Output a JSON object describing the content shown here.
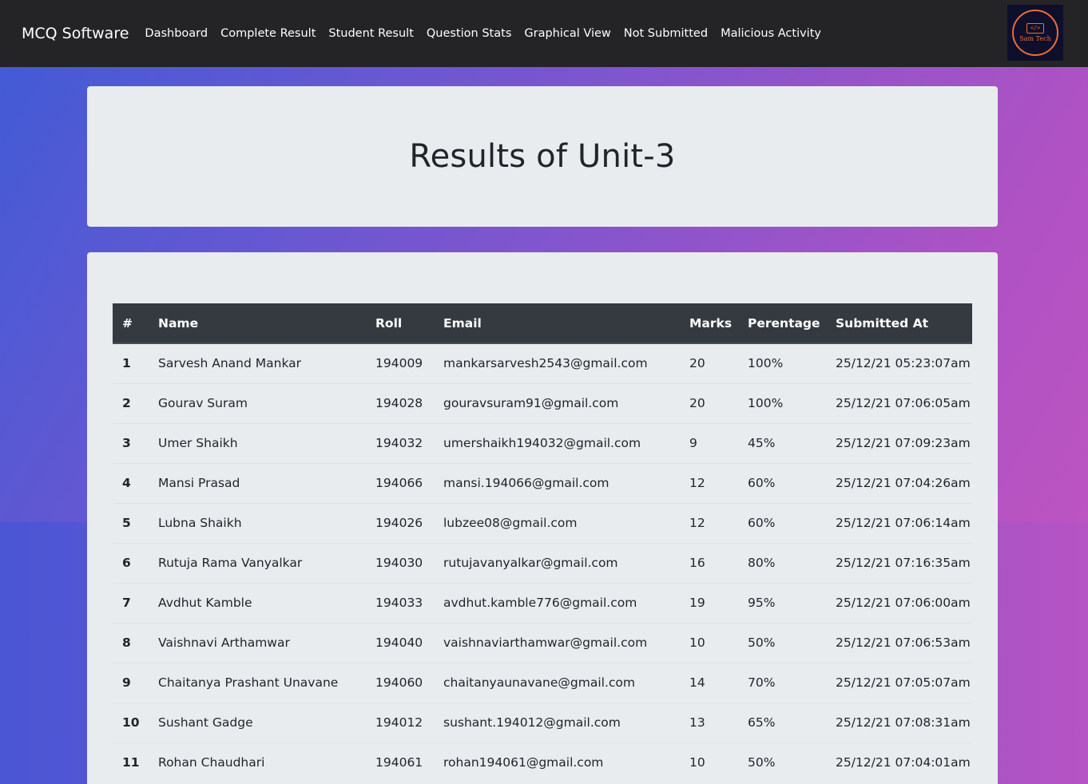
{
  "navbar": {
    "brand": "MCQ Software",
    "links": [
      "Dashboard",
      "Complete Result",
      "Student Result",
      "Question Stats",
      "Graphical View",
      "Not Submitted",
      "Malicious Activity"
    ],
    "logo_text": "Sam Tech",
    "logo_glyph": "</>"
  },
  "page": {
    "title": "Results of Unit-3"
  },
  "table": {
    "headers": [
      "#",
      "Name",
      "Roll",
      "Email",
      "Marks",
      "Perentage",
      "Submitted At"
    ],
    "rows": [
      [
        "1",
        "Sarvesh Anand Mankar",
        "194009",
        "mankarsarvesh2543@gmail.com",
        "20",
        "100%",
        "25/12/21 05:23:07am"
      ],
      [
        "2",
        "Gourav Suram",
        "194028",
        "gouravsuram91@gmail.com",
        "20",
        "100%",
        "25/12/21 07:06:05am"
      ],
      [
        "3",
        "Umer Shaikh",
        "194032",
        "umershaikh194032@gmail.com",
        "9",
        "45%",
        "25/12/21 07:09:23am"
      ],
      [
        "4",
        "Mansi Prasad",
        "194066",
        "mansi.194066@gmail.com",
        "12",
        "60%",
        "25/12/21 07:04:26am"
      ],
      [
        "5",
        "Lubna Shaikh",
        "194026",
        "lubzee08@gmail.com",
        "12",
        "60%",
        "25/12/21 07:06:14am"
      ],
      [
        "6",
        "Rutuja Rama Vanyalkar",
        "194030",
        "rutujavanyalkar@gmail.com",
        "16",
        "80%",
        "25/12/21 07:16:35am"
      ],
      [
        "7",
        "Avdhut Kamble",
        "194033",
        "avdhut.kamble776@gmail.com",
        "19",
        "95%",
        "25/12/21 07:06:00am"
      ],
      [
        "8",
        "Vaishnavi Arthamwar",
        "194040",
        "vaishnaviarthamwar@gmail.com",
        "10",
        "50%",
        "25/12/21 07:06:53am"
      ],
      [
        "9",
        "Chaitanya Prashant Unavane",
        "194060",
        "chaitanyaunavane@gmail.com",
        "14",
        "70%",
        "25/12/21 07:05:07am"
      ],
      [
        "10",
        "Sushant Gadge",
        "194012",
        "sushant.194012@gmail.com",
        "13",
        "65%",
        "25/12/21 07:08:31am"
      ],
      [
        "11",
        "Rohan Chaudhari",
        "194061",
        "rohan194061@gmail.com",
        "10",
        "50%",
        "25/12/21 07:04:01am"
      ]
    ]
  }
}
